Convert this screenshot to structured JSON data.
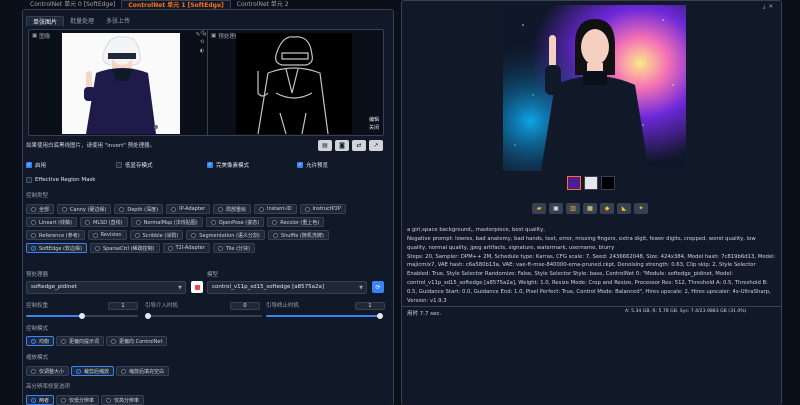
{
  "top_tabs": [
    "ControlNet 单元 0 [SoftEdge]",
    "ControlNet 单元 1 [SoftEdge]",
    "ControlNet 单元 2"
  ],
  "sub_tabs": [
    "单张图片",
    "批量处理",
    "多张上传"
  ],
  "image_label": "图像",
  "preview_label": "预处理结果预览",
  "preview_badges": [
    "编辑",
    "关闭"
  ],
  "hint_text": "如果使用白底黑线图片，请使用 \"invert\" 预处理器。",
  "checkboxes": [
    {
      "label": "启用",
      "checked": true
    },
    {
      "label": "低显存模式",
      "checked": false
    },
    {
      "label": "完美像素模式",
      "checked": true
    },
    {
      "label": "允许预览",
      "checked": true
    },
    {
      "label": "Effective Region Mask",
      "checked": false
    }
  ],
  "control_type_label": "控制类型",
  "control_types": [
    {
      "label": "全部",
      "selected": false
    },
    {
      "label": "Canny (硬边缘)",
      "selected": false
    },
    {
      "label": "Depth (深度)",
      "selected": false
    },
    {
      "label": "IP-Adapter",
      "selected": false
    },
    {
      "label": "局部重绘",
      "selected": false
    },
    {
      "label": "Instant-ID",
      "selected": false
    },
    {
      "label": "InstructP2P",
      "selected": false
    },
    {
      "label": "Lineart (线稿)",
      "selected": false
    },
    {
      "label": "MLSD (直线)",
      "selected": false
    },
    {
      "label": "NormalMap (法线贴图)",
      "selected": false
    },
    {
      "label": "OpenPose (姿态)",
      "selected": false
    },
    {
      "label": "Recolor (重上色)",
      "selected": false
    },
    {
      "label": "Reference (参考)",
      "selected": false
    },
    {
      "label": "Revision",
      "selected": false
    },
    {
      "label": "Scribble (涂鸦)",
      "selected": false
    },
    {
      "label": "Segmentation (语义分割)",
      "selected": false
    },
    {
      "label": "Shuffle (随机洗牌)",
      "selected": false
    },
    {
      "label": "SoftEdge (软边缘)",
      "selected": true
    },
    {
      "label": "SparseCtrl (稀疏控制)",
      "selected": false
    },
    {
      "label": "T2I-Adapter",
      "selected": false
    },
    {
      "label": "Tile (分块)",
      "selected": false
    }
  ],
  "preprocessor": {
    "label": "预处理器",
    "value": "softedge_pidinet"
  },
  "model": {
    "label": "模型",
    "value": "control_v11p_sd15_softedge [a8575a2a]"
  },
  "weight": {
    "label": "控制权重",
    "value": "1",
    "fraction": 0.5
  },
  "start": {
    "label": "引导介入时机",
    "value": "0",
    "fraction": 0.0
  },
  "end": {
    "label": "引导终止时机",
    "value": "1",
    "fraction": 1.0
  },
  "control_mode": {
    "label": "控制模式",
    "options": [
      {
        "label": "均衡",
        "selected": true
      },
      {
        "label": "更偏向提示词",
        "selected": false
      },
      {
        "label": "更偏向 ControlNet",
        "selected": false
      }
    ]
  },
  "resize_mode": {
    "label": "缩放模式",
    "options": [
      {
        "label": "仅调整大小",
        "selected": false
      },
      {
        "label": "裁剪后缩放",
        "selected": true
      },
      {
        "label": "缩放后填充空白",
        "selected": false
      }
    ]
  },
  "hires": {
    "label": "高分辨率修复选项",
    "options": [
      {
        "label": "两者",
        "selected": true
      },
      {
        "label": "仅低分辨率",
        "selected": false
      },
      {
        "label": "仅高分辨率",
        "selected": false
      }
    ]
  },
  "info": {
    "prompt": "a girl,space background,, masterpiece, best quality,",
    "params": "Negative prompt: lowres, bad anatomy, bad hands, text, error, missing fingers, extra digit, fewer digits, cropped, worst quality, low quality, normal quality, jpeg artifacts, signature, watermark, username, blurry\nSteps: 20, Sampler: DPM++ 2M, Schedule type: Karras, CFG scale: 7, Seed: 2436662048, Size: 424x384, Model hash: 7c819b6d13, Model: majicmix7, VAE hash: c6a580b13a, VAE: vae-ft-mse-840000-ema-pruned.ckpt, Denoising strength: 0.63, Clip skip: 2, Style Selector Enabled: True, Style Selector Randomize: False, Style Selector Style: base, ControlNet 0: \"Module: softedge_pidinet, Model: control_v11p_sd15_softedge [a8575a2a], Weight: 1.0, Resize Mode: Crop and Resize, Processor Res: 512, Threshold A: 0.5, Threshold B: 0.5, Guidance Start: 0.0, Guidance End: 1.0, Pixel Perfect: True, Control Mode: Balanced\", Hires upscale: 2, Hires upscaler: 4x-UltraSharp, Version: v1.9.3",
    "time": "用时 7.7 sec.",
    "memory": "A: 5.34 GB, R: 5.78 GB, Sys: 7.4/23.9883 GB (31.0%)"
  },
  "colors": {
    "accent": "#3b82f6",
    "orange": "#f97316",
    "bg": "#0b0f19",
    "panel": "#111827"
  }
}
